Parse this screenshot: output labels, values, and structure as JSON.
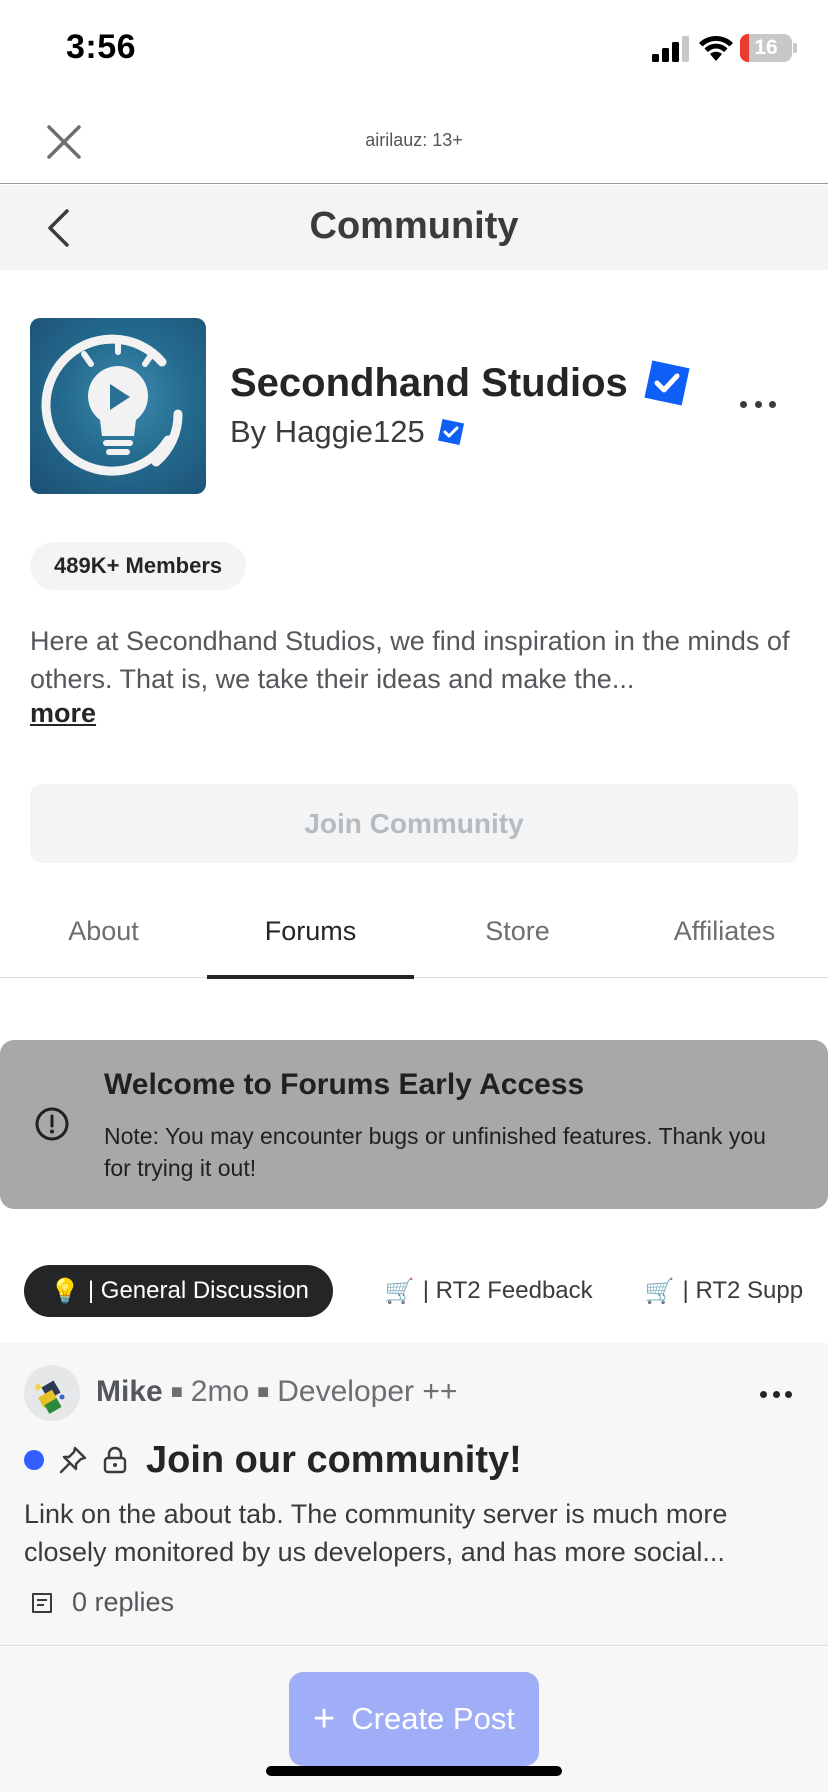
{
  "status_bar": {
    "time": "3:56",
    "battery_level": "16",
    "icons": [
      "cellular-signal-icon",
      "wifi-icon",
      "battery-icon"
    ]
  },
  "sheet": {
    "account_label": "airilauz: 13+",
    "close_icon": "close-icon"
  },
  "nav": {
    "title": "Community",
    "back_icon": "chevron-left-icon"
  },
  "community": {
    "name": "Secondhand Studios",
    "byline": "By Haggie125",
    "members": "489K+ Members",
    "description": "Here at Secondhand Studios, we find inspiration in the minds of others. That is, we take their ideas and make the...",
    "more_label": "more",
    "join_label": "Join Community",
    "verified_color": "#0e5ff5"
  },
  "tabs": [
    {
      "label": "About",
      "active": false
    },
    {
      "label": "Forums",
      "active": true
    },
    {
      "label": "Store",
      "active": false
    },
    {
      "label": "Affiliates",
      "active": false
    }
  ],
  "banner": {
    "title": "Welcome to Forums Early Access",
    "body": "Note: You may encounter bugs or unfinished features. Thank you for trying it out!",
    "icon": "exclamation-circle-icon"
  },
  "chips": [
    {
      "icon": "💡",
      "label": "| General Discussion",
      "active": true
    },
    {
      "icon": "🛒",
      "label": "| RT2 Feedback",
      "active": false
    },
    {
      "icon": "🛒",
      "label": "| RT2 Supp",
      "active": false
    }
  ],
  "post": {
    "author": "Mike",
    "age": "2mo",
    "role": "Developer ++",
    "title": "Join our community!",
    "body": "Link on the about tab. The community server is much more closely monitored by us developers, and has more social...",
    "replies": "0 replies",
    "unread_color": "#335fff"
  },
  "create_post": {
    "label": "Create Post",
    "icon": "plus-icon",
    "color": "#a0aef8"
  }
}
